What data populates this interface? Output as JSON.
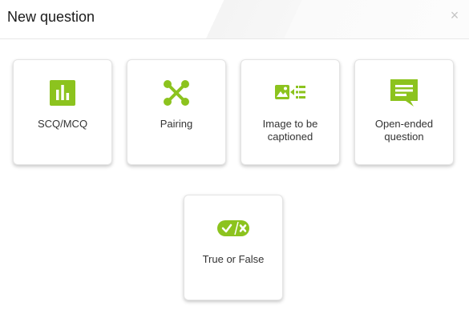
{
  "dialog": {
    "title": "New question",
    "close_label": "×"
  },
  "colors": {
    "accent": "#8cc31e"
  },
  "question_types": [
    {
      "label": "SCQ/MCQ",
      "icon": "bar-chart-icon"
    },
    {
      "label": "Pairing",
      "icon": "pairing-icon"
    },
    {
      "label": "Image to be captioned",
      "icon": "image-caption-icon"
    },
    {
      "label": "Open-ended question",
      "icon": "speech-bubble-icon"
    },
    {
      "label": "True or False",
      "icon": "true-false-icon"
    }
  ]
}
